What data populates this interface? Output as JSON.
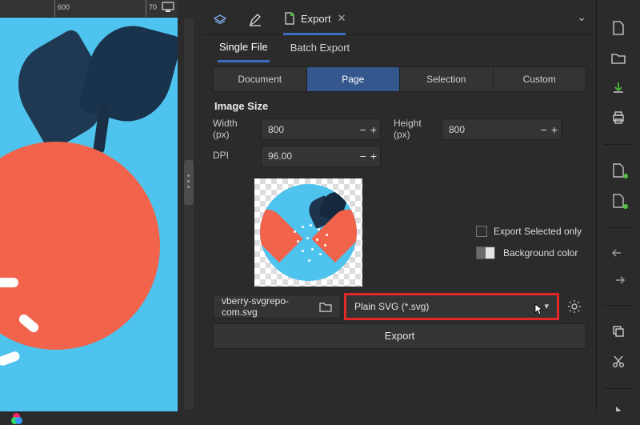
{
  "ruler": {
    "marks": [
      "600",
      "70"
    ]
  },
  "tabs": {
    "export_label": "Export"
  },
  "subtabs": {
    "single": "Single File",
    "batch": "Batch Export"
  },
  "segments": {
    "document": "Document",
    "page": "Page",
    "selection": "Selection",
    "custom": "Custom"
  },
  "size": {
    "heading": "Image Size",
    "width_label": "Width (px)",
    "width_value": "800",
    "height_label": "Height (px)",
    "height_value": "800",
    "dpi_label": "DPI",
    "dpi_value": "96.00"
  },
  "options": {
    "selected_only": "Export Selected only",
    "bgcolor": "Background color"
  },
  "file": {
    "name": "vberry-svgrepo-com.svg",
    "format": "Plain SVG (*.svg)"
  },
  "export_button": "Export"
}
